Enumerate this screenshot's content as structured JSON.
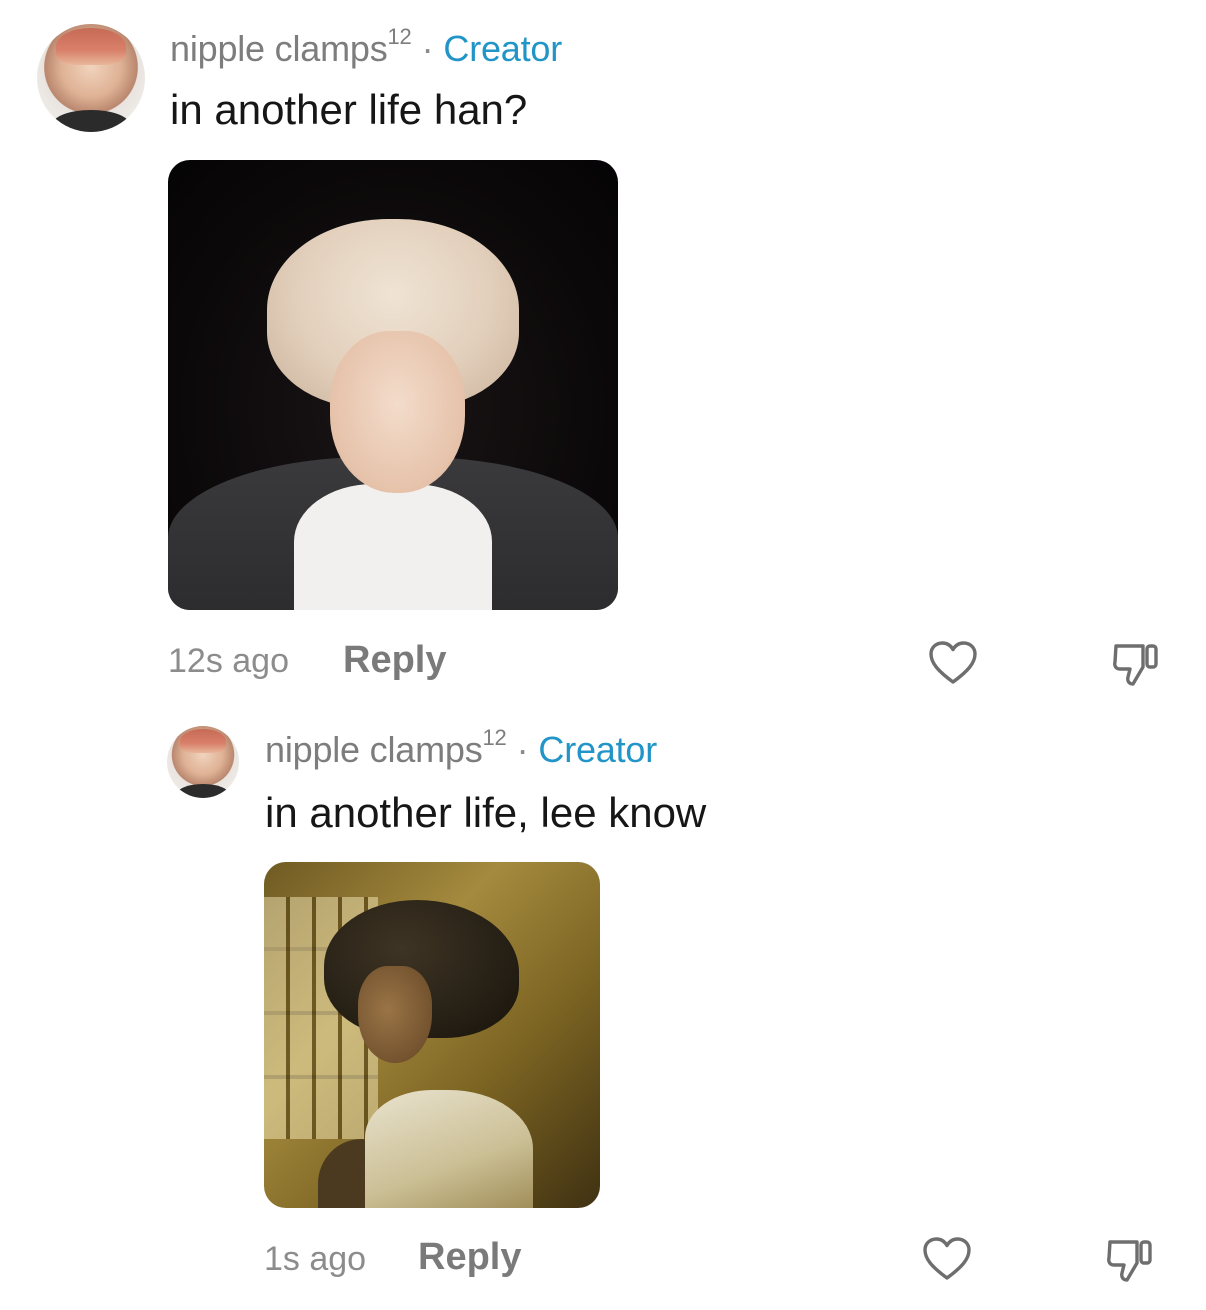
{
  "comments": [
    {
      "username": "nipple clamps",
      "username_sup": "12",
      "separator": "·",
      "badge": "Creator",
      "text": "in another life han?",
      "time": "12s ago",
      "reply_label": "Reply",
      "like_icon": "heart-icon",
      "dislike_icon": "thumbs-down-icon"
    },
    {
      "username": "nipple clamps",
      "username_sup": "12",
      "separator": "·",
      "badge": "Creator",
      "text": "in another life, lee know",
      "time": "1s ago",
      "reply_label": "Reply",
      "like_icon": "heart-icon",
      "dislike_icon": "thumbs-down-icon"
    }
  ],
  "colors": {
    "creator_badge": "#2295c8",
    "username": "#7d7d7d",
    "comment_text": "#161616",
    "meta": "#8c8c8c"
  }
}
